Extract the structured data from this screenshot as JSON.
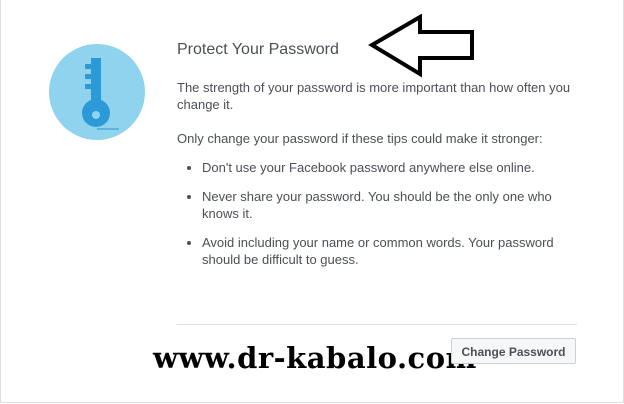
{
  "dialog": {
    "title": "Protect Your Password",
    "intro": "The strength of your password is more important than how often you change it.",
    "advice": "Only change your password if these tips could make it stronger:",
    "tips": [
      "Don't use your Facebook password anywhere else online.",
      "Never share your password. You should be the only one who knows it.",
      "Avoid including your name or common words. Your password should be difficult to guess."
    ],
    "button_label": "Change Password"
  },
  "watermark": {
    "text": "www.dr-kabalo.com"
  },
  "illustration": {
    "icon": "key-icon",
    "circle_color": "#8fd3ee",
    "key_color": "#2c9ad6"
  },
  "annotation": {
    "icon": "arrow-left-icon"
  }
}
